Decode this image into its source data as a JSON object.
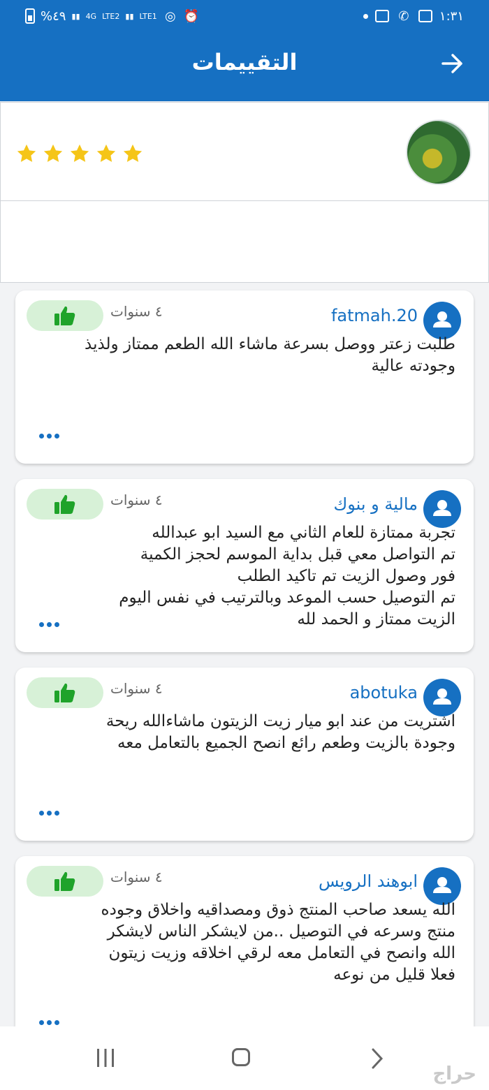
{
  "status_bar": {
    "battery": "%٤٩",
    "network1": "4G",
    "network2": "LTE2",
    "network3": "LTE1",
    "time": "١:٣١"
  },
  "app_bar": {
    "title": "التقييمات"
  },
  "product": {
    "rating_stars": 5
  },
  "reviews": [
    {
      "username": "fatmah.20",
      "time": "٤ سنوات",
      "text": "طلبت زعتر ووصل بسرعة ماشاء الله الطعم ممتاز ولذيذ\nوجودته عالية"
    },
    {
      "username": "مالية و بنوك",
      "time": "٤ سنوات",
      "text": "تجربة ممتازة للعام الثاني مع السيد ابو عبدالله\nتم التواصل معي قبل بداية الموسم لحجز الكمية\nفور وصول الزيت تم تاكيد الطلب\nتم التوصيل حسب الموعد وبالترتيب في نفس اليوم\nالزيت ممتاز و الحمد لله"
    },
    {
      "username": "abotuka",
      "time": "٤ سنوات",
      "text": "اشتريت من عند ابو ميار زيت الزيتون ماشاءالله ريحة\nوجودة بالزيت  وطعم رائع انصح الجميع بالتعامل معه"
    },
    {
      "username": "ابوهند الرويس",
      "time": "٤ سنوات",
      "text": "الله يسعد صاحب المنتج ذوق ومصداقيه واخلاق وجوده\nمنتج وسرعه في التوصيل ..من لايشكر الناس لايشكر\nالله وانصح في التعامل معه لرقي اخلاقه وزيت زيتون\nفعلا قليل من نوعه"
    }
  ],
  "watermark": "حراج",
  "colors": {
    "primary": "#1670c2",
    "like_bg": "#d7f1d7",
    "like_icon": "#1fa32a",
    "star": "#f5c518"
  }
}
